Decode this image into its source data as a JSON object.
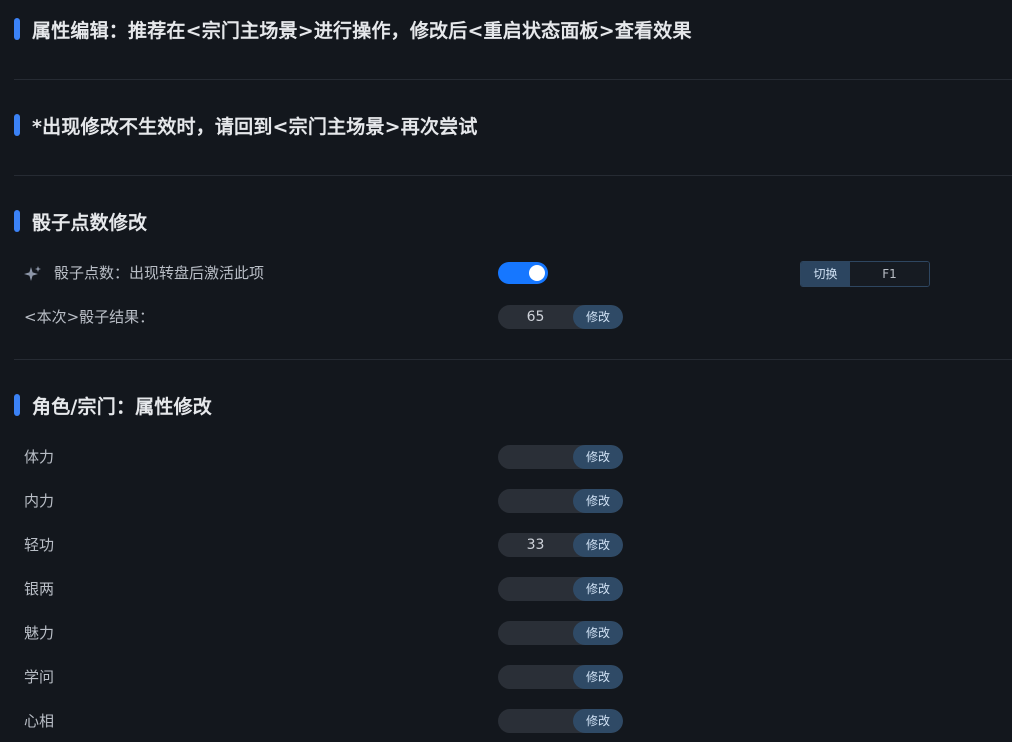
{
  "sections": {
    "notice1": "属性编辑：推荐在<宗门主场景>进行操作，修改后<重启状态面板>查看效果",
    "notice2": "*出现修改不生效时，请回到<宗门主场景>再次尝试",
    "dice": "骰子点数修改",
    "attrs": "角色/宗门：属性修改"
  },
  "dice": {
    "toggle_label": "骰子点数：出现转盘后激活此项",
    "toggle_on": true,
    "hotkey_button": "切换",
    "hotkey_key": "F1",
    "result_label": "<本次>骰子结果：",
    "result_value": "65",
    "result_button": "修改"
  },
  "attrs": [
    {
      "label": "体力",
      "value": "",
      "button": "修改"
    },
    {
      "label": "内力",
      "value": "",
      "button": "修改"
    },
    {
      "label": "轻功",
      "value": "33",
      "button": "修改"
    },
    {
      "label": "银两",
      "value": "",
      "button": "修改"
    },
    {
      "label": "魅力",
      "value": "",
      "button": "修改"
    },
    {
      "label": "学问",
      "value": "",
      "button": "修改"
    },
    {
      "label": "心相",
      "value": "",
      "button": "修改"
    }
  ],
  "colors": {
    "accent": "#3b82f6",
    "toggle": "#1677ff",
    "background": "#13171d"
  }
}
